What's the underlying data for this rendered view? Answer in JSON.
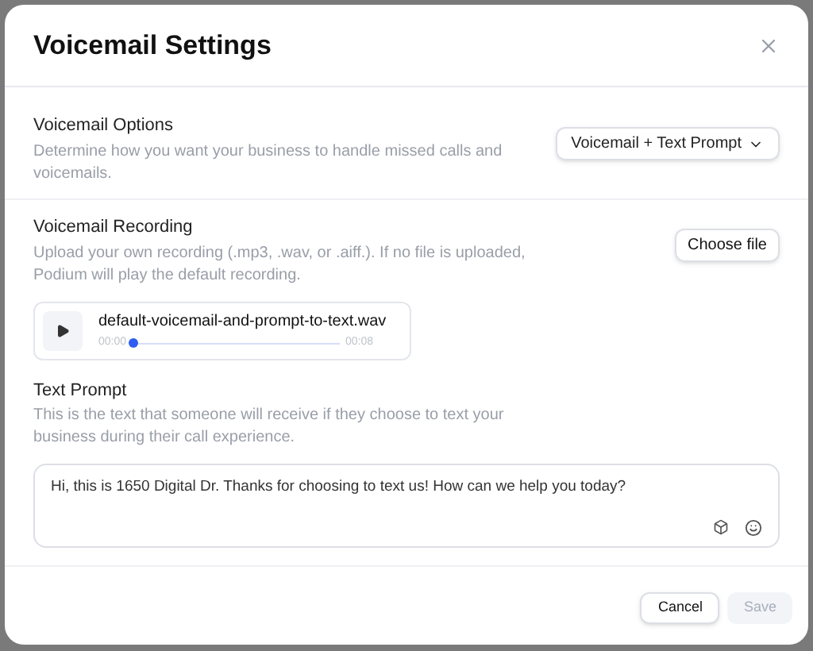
{
  "dialog": {
    "title": "Voicemail Settings"
  },
  "voicemail_options": {
    "label": "Voicemail Options",
    "description": "Determine how you want your business to handle missed calls and voicemails.",
    "dropdown_value": "Voicemail + Text Prompt"
  },
  "voicemail_recording": {
    "label": "Voicemail Recording",
    "description": "Upload your own recording (.mp3, .wav, or .aiff.). If no file is uploaded, Podium will play the default recording.",
    "button": "Choose file",
    "player": {
      "file_name": "default-voicemail-and-prompt-to-text.wav",
      "elapsed": "00:00",
      "duration": "00:08",
      "level": 0
    }
  },
  "text_prompt": {
    "label": "Text Prompt",
    "description": "This is the text that someone will receive if they choose to text your business during their call experience.",
    "value": "Hi, this is 1650 Digital Dr. Thanks for choosing to text us! How can we help you today?"
  },
  "footer": {
    "buttons": [
      {
        "label": "Cancel",
        "disabled": false
      },
      {
        "label": "Save",
        "disabled": true
      }
    ]
  }
}
